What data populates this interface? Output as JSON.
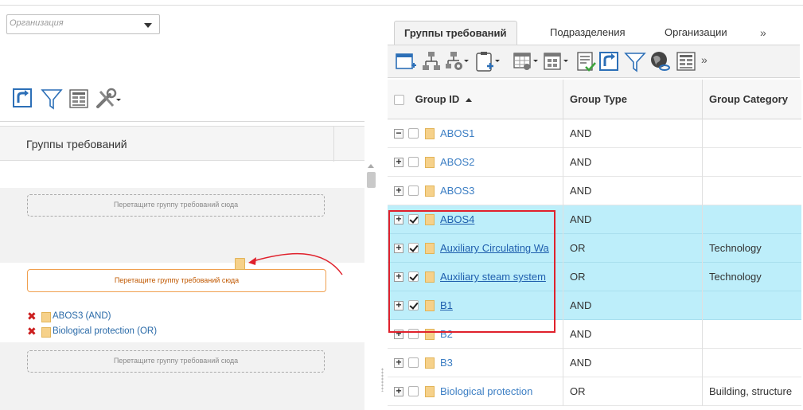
{
  "org_select": {
    "placeholder": "Организация"
  },
  "left_panel": {
    "grid_title": "Группы требований",
    "drop_zones": [
      "Перетащите группу требований сюда",
      "Перетащите группу требований сюда",
      "Перетащите группу требований сюда"
    ],
    "selected_items": [
      {
        "label": "ABOS3 (AND)"
      },
      {
        "label": "Biological protection (OR)"
      }
    ]
  },
  "tabs": [
    {
      "label": "Группы требований",
      "active": true
    },
    {
      "label": "Подразделения",
      "active": false
    },
    {
      "label": "Организации",
      "active": false
    }
  ],
  "tabs_more": "»",
  "toolbar_more": "»",
  "grid": {
    "columns": [
      "Group ID",
      "Group Type",
      "Group Category"
    ],
    "rows": [
      {
        "expander": "−",
        "checked": false,
        "id": "ABOS1",
        "type": "AND",
        "category": "",
        "selected": false
      },
      {
        "expander": "+",
        "checked": false,
        "id": "ABOS2",
        "type": "AND",
        "category": "",
        "selected": false
      },
      {
        "expander": "+",
        "checked": false,
        "id": "ABOS3",
        "type": "AND",
        "category": "",
        "selected": false
      },
      {
        "expander": "+",
        "checked": true,
        "id": "ABOS4",
        "type": "AND",
        "category": "",
        "selected": true
      },
      {
        "expander": "+",
        "checked": true,
        "id": "Auxiliary Circulating Wa",
        "type": "OR",
        "category": "Technology",
        "selected": true
      },
      {
        "expander": "+",
        "checked": true,
        "id": "Auxiliary steam system",
        "type": "OR",
        "category": "Technology",
        "selected": true
      },
      {
        "expander": "+",
        "checked": true,
        "id": "B1",
        "type": "AND",
        "category": "",
        "selected": true
      },
      {
        "expander": "+",
        "checked": false,
        "id": "B2",
        "type": "AND",
        "category": "",
        "selected": false
      },
      {
        "expander": "+",
        "checked": false,
        "id": "B3",
        "type": "AND",
        "category": "",
        "selected": false
      },
      {
        "expander": "+",
        "checked": false,
        "id": "Biological protection",
        "type": "OR",
        "category": "Building, structure",
        "selected": false
      }
    ]
  },
  "colors": {
    "selected_row": "#bdeefa",
    "highlight_border": "#e0212c",
    "link": "#3d7fc4",
    "drop_active_border": "#f0a050"
  }
}
